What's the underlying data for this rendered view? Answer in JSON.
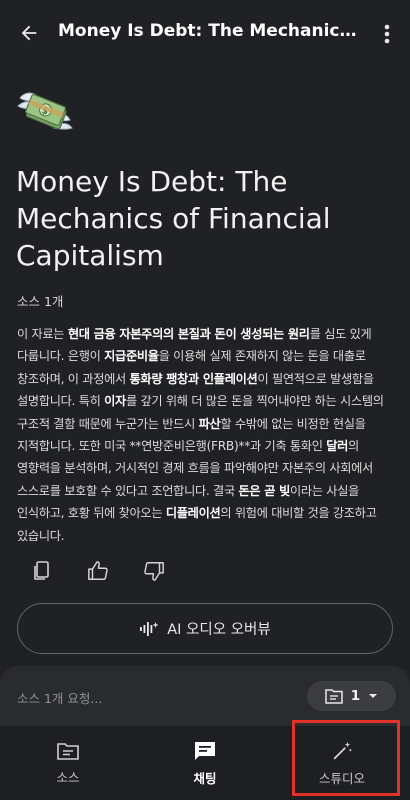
{
  "header": {
    "title": "Money Is Debt: The Mechanics of Financial Capitalism",
    "back_icon": "arrow-back-icon",
    "more_icon": "more-vert-icon"
  },
  "notebook": {
    "emoji_icon": "money-with-wings-icon",
    "title": "Money Is Debt: The Mechanics of Financial Capitalism",
    "source_count": "소스 1개"
  },
  "summary": {
    "segments": [
      {
        "t": "이 자료는 ",
        "b": false
      },
      {
        "t": "현대 금융 자본주의의 본질과 돈이 생성되는 원리",
        "b": true
      },
      {
        "t": "를 심도 있게 다룹니다. 은행이 ",
        "b": false
      },
      {
        "t": "지급준비율",
        "b": true
      },
      {
        "t": "을 이용해 실제 존재하지 않는 돈을 대출로 창조하며, 이 과정에서 ",
        "b": false
      },
      {
        "t": "통화량 팽창과 인플레이션",
        "b": true
      },
      {
        "t": "이 필연적으로 발생함을 설명합니다. 특히 ",
        "b": false
      },
      {
        "t": "이자",
        "b": true
      },
      {
        "t": "를 갚기 위해 더 많은 돈을 찍어내야만 하는 시스템의 구조적 결함 때문에 누군가는 반드시 ",
        "b": false
      },
      {
        "t": "파산",
        "b": true
      },
      {
        "t": "할 수밖에 없는 비정한 현실을 지적합니다. 또한 미국 **연방준비은행(FRB)**과 기축 통화인 ",
        "b": false
      },
      {
        "t": "달러",
        "b": true
      },
      {
        "t": "의 영향력을 분석하며, 거시적인 경제 흐름을 파악해야만 자본주의 사회에서 스스로를 보호할 수 있다고 조언합니다. 결국 ",
        "b": false
      },
      {
        "t": "돈은 곧 빚",
        "b": true
      },
      {
        "t": "이라는 사실을 인식하고, 호황 뒤에 찾아오는 ",
        "b": false
      },
      {
        "t": "디플레이션",
        "b": true
      },
      {
        "t": "의 위험에 대비할 것을 강조하고 있습니다.",
        "b": false
      }
    ]
  },
  "actions": {
    "copy_icon": "copy-note-icon",
    "like_icon": "thumbs-up-icon",
    "dislike_icon": "thumbs-down-icon"
  },
  "audio": {
    "label": "AI 오디오 오버뷰",
    "icon": "audio-spark-icon"
  },
  "chat": {
    "placeholder": "소스 1개 요청...",
    "source_chip_count": "1",
    "chip_icon": "source-list-icon",
    "chip_dropdown_icon": "caret-down-icon"
  },
  "nav": {
    "items": [
      {
        "label": "소스",
        "icon": "sources-icon",
        "active": false
      },
      {
        "label": "채팅",
        "icon": "chat-icon",
        "active": true
      },
      {
        "label": "스튜디오",
        "icon": "magic-wand-icon",
        "active": false
      }
    ]
  },
  "colors": {
    "background": "#202124",
    "panel": "#2a2b2e",
    "nav": "#1e1f22",
    "highlight": "#e2322a"
  }
}
